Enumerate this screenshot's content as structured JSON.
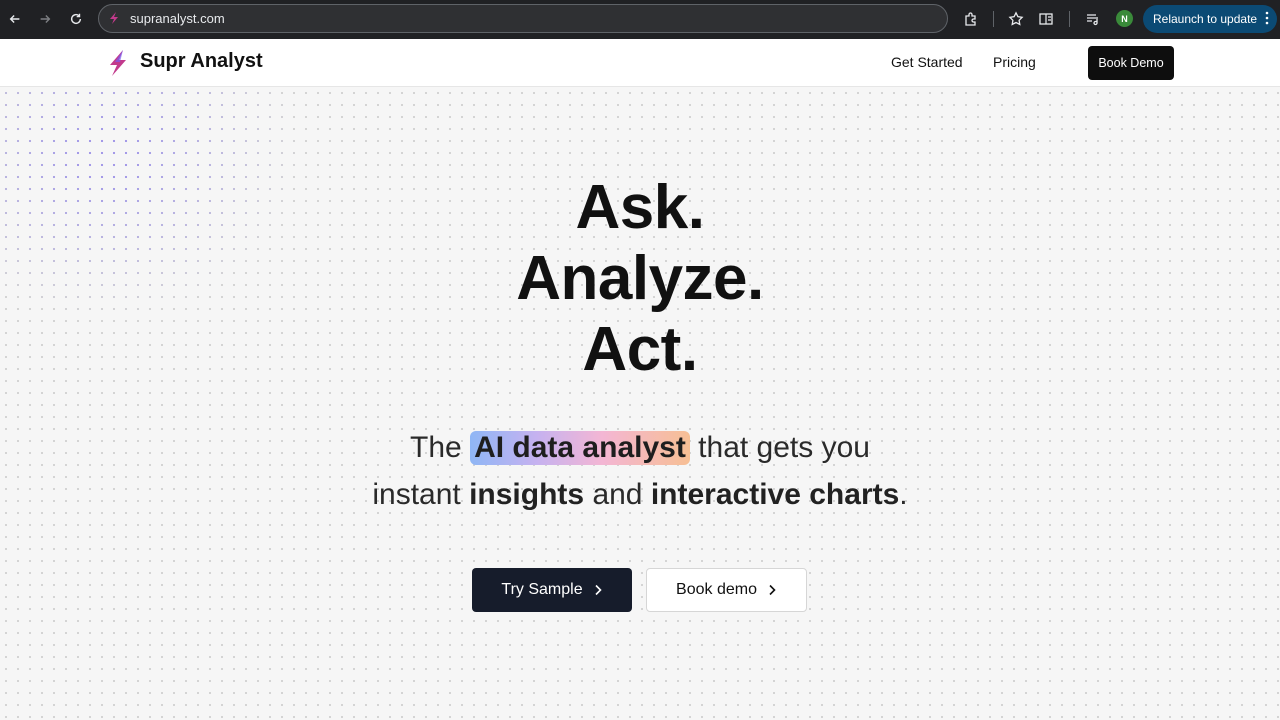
{
  "browser": {
    "url": "supranalyst.com",
    "profile_initial": "N",
    "relaunch_label": "Relaunch to update"
  },
  "site": {
    "brand": "Supr Analyst",
    "nav": {
      "get_started": "Get Started",
      "pricing": "Pricing",
      "book_demo": "Book Demo"
    }
  },
  "hero": {
    "line1": "Ask.",
    "line2": "Analyze.",
    "line3": "Act.",
    "sub_the": "The",
    "sub_highlight": "AI data analyst",
    "sub_rest1": "that gets you",
    "sub_instant": "instant",
    "sub_insights": "insights",
    "sub_and": "and",
    "sub_charts": "interactive charts",
    "sub_period": "."
  },
  "cta": {
    "primary": "Try Sample",
    "secondary": "Book demo"
  },
  "colors": {
    "chrome_bg": "#202124",
    "relaunch_bg": "#0b4a74",
    "primary_btn": "#161c2b",
    "logo_accent": "#c23a8c"
  }
}
